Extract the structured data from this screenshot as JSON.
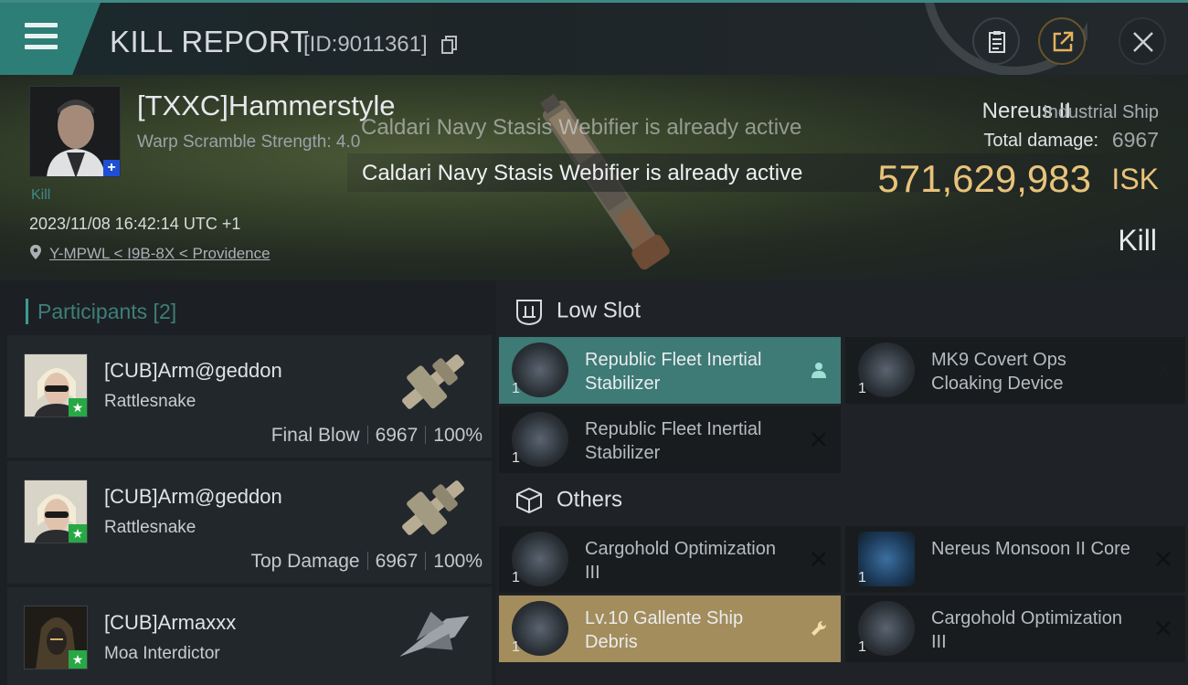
{
  "header": {
    "title": "KILL REPORT",
    "report_id": "[ID:9011361]",
    "icons": [
      "menu-icon",
      "copy-icon",
      "clipboard-icon",
      "share-icon",
      "close-icon"
    ]
  },
  "victim": {
    "name": "[TXXC]Hammerstyle",
    "warp_scramble": "Warp Scramble Strength: 4.0",
    "kill_tag": "Kill",
    "datetime": "2023/11/08 16:42:14 UTC +1",
    "location": "Y-MPWL < I9B-8X < Providence",
    "ship_name": "Nereus II",
    "ship_class": "Industrial Ship",
    "total_damage_label": "Total damage:",
    "total_damage": "6967",
    "isk_value": "571,629,983",
    "isk_unit": "ISK",
    "result": "Kill"
  },
  "toasts": {
    "faded": "Caldari Navy Stasis Webifier is already active",
    "active": "Caldari Navy Stasis Webifier is already active"
  },
  "participants": {
    "title": "Participants [2]",
    "list": [
      {
        "name": "[CUB]Arm@geddon",
        "ship": "Rattlesnake",
        "tag": "Final Blow",
        "damage": "6967",
        "percent": "100%"
      },
      {
        "name": "[CUB]Arm@geddon",
        "ship": "Rattlesnake",
        "tag": "Top Damage",
        "damage": "6967",
        "percent": "100%"
      },
      {
        "name": "[CUB]Armaxxx",
        "ship": "Moa Interdictor"
      }
    ]
  },
  "fittings": {
    "low_slot_title": "Low Slot",
    "others_title": "Others",
    "low_slot": [
      {
        "name": "Republic Fleet Inertial Stabilizer",
        "qty": "1",
        "status": "user",
        "highlight": "teal"
      },
      {
        "name": "MK9 Covert Ops Cloaking Device",
        "qty": "1",
        "status": "destroyed"
      },
      {
        "name": "Republic Fleet Inertial Stabilizer",
        "qty": "1",
        "status": "destroyed"
      }
    ],
    "others": [
      {
        "name": "Cargohold Optimization III",
        "qty": "1",
        "status": "destroyed"
      },
      {
        "name": "Nereus Monsoon II Core",
        "qty": "1",
        "status": "destroyed"
      },
      {
        "name": "Lv.10 Gallente Ship Debris",
        "qty": "1",
        "status": "wrench",
        "highlight": "gold"
      },
      {
        "name": "Cargohold Optimization III",
        "qty": "1",
        "status": "destroyed"
      }
    ]
  },
  "colors": {
    "accent": "#3f9a93",
    "isk": "#e8c37a",
    "highlight_teal": "#3e7a76",
    "highlight_gold": "#a38d5c"
  }
}
